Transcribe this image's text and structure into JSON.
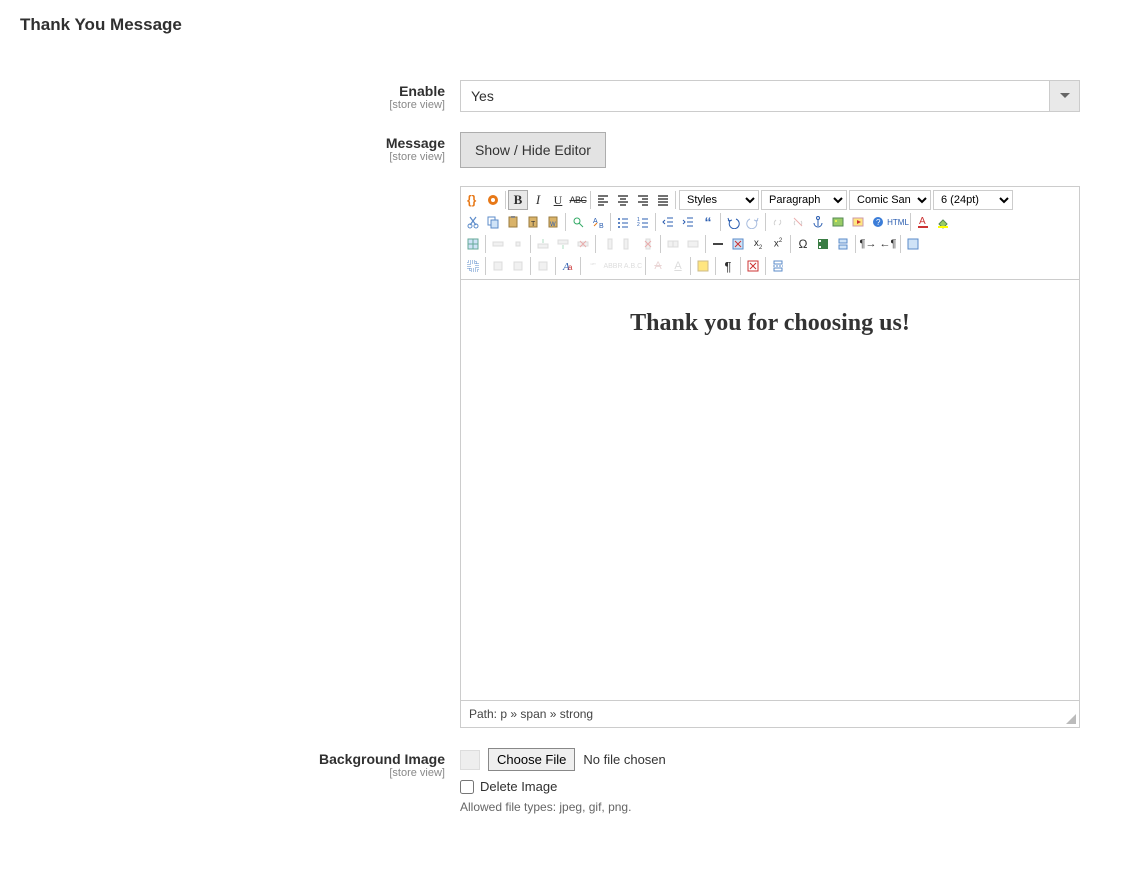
{
  "section_title": "Thank You Message",
  "fields": {
    "enable": {
      "label": "Enable",
      "scope": "[store view]",
      "value": "Yes"
    },
    "message": {
      "label": "Message",
      "scope": "[store view]",
      "toggle_btn": "Show / Hide Editor"
    },
    "bg_image": {
      "label": "Background Image",
      "scope": "[store view]",
      "choose": "Choose File",
      "status": "No file chosen",
      "delete_label": "Delete Image",
      "hint": "Allowed file types: jpeg, gif, png."
    }
  },
  "editor": {
    "styles": "Styles",
    "format": "Paragraph",
    "font": "Comic Sans MS",
    "size": "6 (24pt)",
    "content": "Thank you for choosing us!",
    "path_label": "Path:",
    "path": "p » span » strong"
  }
}
